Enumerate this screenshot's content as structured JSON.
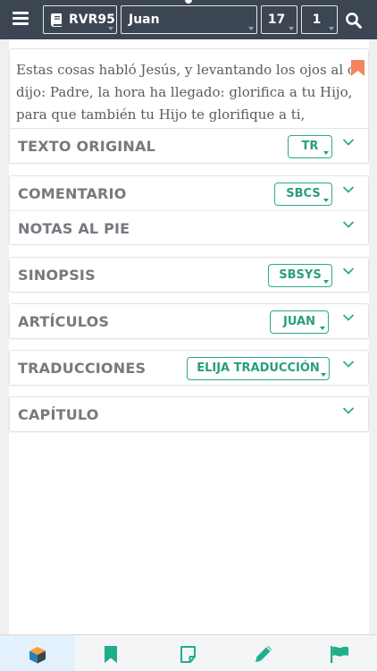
{
  "header": {
    "version": "RVR95",
    "book": "Juan",
    "chapter": "17",
    "verse": "1"
  },
  "verse": {
    "lines": [
      "Estas cosas habló Jesús, y levantando los ojos al cielo,",
      "dijo: Padre, la hora ha llegado: glorifica a tu Hijo,",
      "para que también tu Hijo te glorifique a ti,"
    ]
  },
  "sections": {
    "texto_original": {
      "title": "TEXTO ORIGINAL",
      "button": "TR"
    },
    "comentario": {
      "title": "COMENTARIO",
      "button": "SBCS"
    },
    "notas": {
      "title": "NOTAS AL PIE"
    },
    "sinopsis": {
      "title": "SINOPSIS",
      "button": "SBSYS"
    },
    "articulos": {
      "title": "ARTÍCULOS",
      "button": "JUAN"
    },
    "traducciones": {
      "title": "TRADUCCIONES",
      "button": "ELIJA TRADUCCIÓN"
    },
    "capitulo": {
      "title": "CAPÍTULO"
    }
  },
  "colors": {
    "topbar": "#3c4552",
    "accent": "#2aaa8a",
    "bookmark": "#f4845f",
    "tab_icon": "#1fae8b",
    "active_tab_bg": "#e2f1fb"
  },
  "icons": {
    "menu": "hamburger-icon",
    "version": "book-icon",
    "search": "search-icon",
    "bookmark": "bookmark-icon",
    "expand": "chevron-down-icon",
    "tabs": [
      "cube-icon",
      "bookmark-icon",
      "note-icon",
      "pencil-icon",
      "flag-icon"
    ]
  }
}
